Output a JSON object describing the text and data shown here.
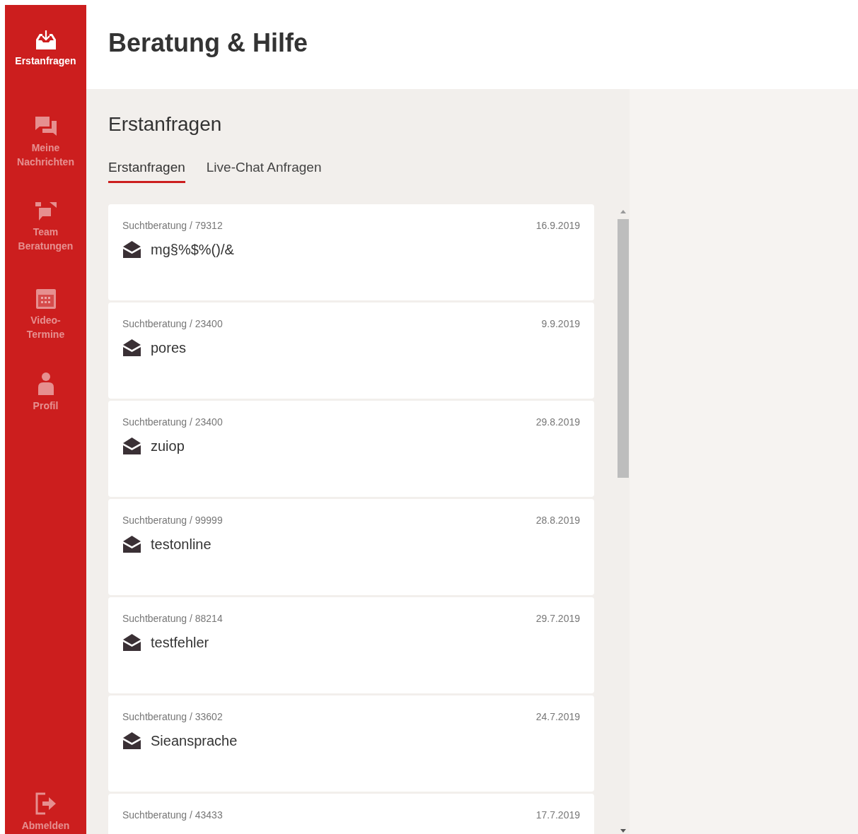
{
  "sidebar": {
    "items": [
      {
        "label": "Erstanfragen",
        "selected": true
      },
      {
        "label": "Meine Nachrichten",
        "selected": false
      },
      {
        "label": "Team Beratungen",
        "selected": false
      },
      {
        "label": "Video-Termine",
        "selected": false
      },
      {
        "label": "Profil",
        "selected": false
      }
    ],
    "logout": {
      "label": "Abmelden"
    }
  },
  "header": {
    "title": "Beratung & Hilfe"
  },
  "section": {
    "title": "Erstanfragen"
  },
  "tabs": [
    {
      "label": "Erstanfragen",
      "selected": true
    },
    {
      "label": "Live-Chat Anfragen",
      "selected": false
    }
  ],
  "requests": [
    {
      "topic": "Suchtberatung / 79312",
      "date": "16.9.2019",
      "subject": "mg§%$%()/&"
    },
    {
      "topic": "Suchtberatung / 23400",
      "date": "9.9.2019",
      "subject": "pores"
    },
    {
      "topic": "Suchtberatung / 23400",
      "date": "29.8.2019",
      "subject": "zuiop"
    },
    {
      "topic": "Suchtberatung / 99999",
      "date": "28.8.2019",
      "subject": "testonline"
    },
    {
      "topic": "Suchtberatung / 88214",
      "date": "29.7.2019",
      "subject": "testfehler"
    },
    {
      "topic": "Suchtberatung / 33602",
      "date": "24.7.2019",
      "subject": "Sieansprache"
    },
    {
      "topic": "Suchtberatung / 43433",
      "date": "17.7.2019"
    }
  ]
}
